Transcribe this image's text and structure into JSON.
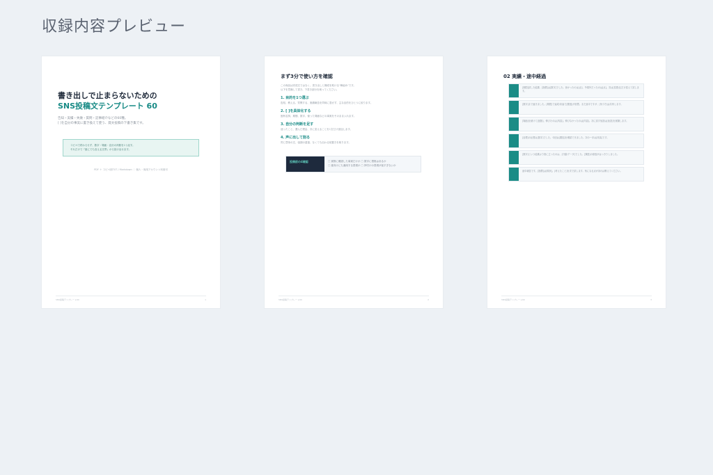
{
  "header": {
    "title": "収録内容プレビュー"
  },
  "pages": [
    {
      "title_line1": "書き出しで止まらないための",
      "title_line2": "SNS投稿文テンプレート 60",
      "desc_line1": "告知・実績・失敗・質問・記事紹介などの60種。",
      "desc_line2": "[ ]を自分の事実に置き換えて使う、発文投稿の下書き集です。",
      "note_line1": "コピペで終わらせず、数字・場面・自分の判断を1つ足す。",
      "note_line2": "それだけで「誰にでも言える文章」から抜け出せます。",
      "credit": "PDF ＋ コピペ用TXT / Markdown ｜ 個人・商用アカウント利用可",
      "footer_left": "SNS投稿テンプレート60",
      "footer_right": "1"
    },
    {
      "heading": "まず3分で使い方を確認",
      "intro_line1": "この商品は完成文ではなく、書き出しと構成を助ける\"骨組み\"です。",
      "intro_line2": "以下を意識して書き、下書き部分を削ってください。",
      "steps": [
        {
          "title": "1. 目的を1つ選ぶ",
          "body": "告知、教える、質問する、実績報告を同時に混ぜず、主な目的をひとつに絞ります。"
        },
        {
          "title": "2. [ ]を具体化する",
          "body": "固有名詞、期間、数字、使った場面などの事実をそのまま入れます。"
        },
        {
          "title": "3. 自分の判断を足す",
          "body": "迷ったこと、選んだ理由、次に変えることを1文だけ追加します。"
        },
        {
          "title": "4. 声に出して削る",
          "body": "同じ意味の文、強調の重複、なくても伝わる前置きを削ります。"
        }
      ],
      "checklist": {
        "label": "投稿前の4確認",
        "line1": "□ 実際に確認した事実だけか  □ 数字に根拠はあるか",
        "line2": "□ 誰向けにも通用する表現か  □ 押付けの表現が強すぎないか"
      },
      "footer_left": "SNS投稿テンプレート60",
      "footer_right": "2"
    },
    {
      "heading": "02 実績・途中経過",
      "cards": [
        {
          "text": "[期間]試した結果、[指標]は[数字]でした。良かったのは[点]、予想外だったのは[点]。次は[変更点]だけ変えて試します。"
        },
        {
          "text": "[数字]まで届きました。[期間]で達成/未達で[要因]が影響。まだ途中ですが、[気づき]は共有します。"
        },
        {
          "text": "[場面]を続けて[回数]、伸びたのは[内容]。伸びなかったのは[内容]。次に試す仮説は[仮説]を実験します。"
        },
        {
          "text": "[目標]の反響は[数字]でした。今回は[要因]を確認できました。次の一手は[改善]です。"
        },
        {
          "text": "[数字]という結果より役に立ったのは、[行動/データ]でした。[課題]の原因がはっきりしました。"
        },
        {
          "text": "途中報告です。[指標]は[現状]。[考えたこと]を次で試します。気になる点があれば教えてください。"
        }
      ],
      "footer_left": "SNS投稿テンプレート60",
      "footer_right": "3"
    }
  ]
}
